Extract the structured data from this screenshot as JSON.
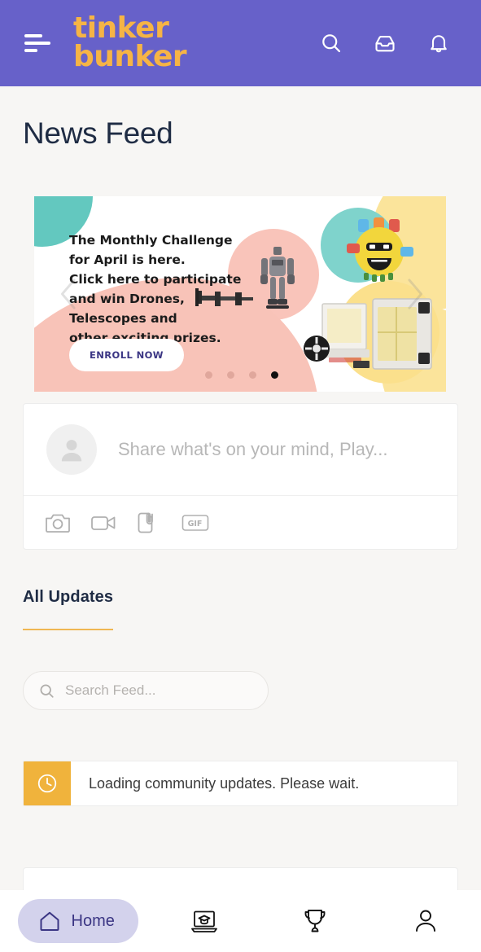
{
  "header": {
    "menu_icon": "hamburger-menu-icon",
    "logo_line1": "tinker",
    "logo_line2": "bunker",
    "logo_color": "#f6b445",
    "bg_color": "#6761c9",
    "actions": [
      {
        "name": "search-icon",
        "label": "Search"
      },
      {
        "name": "inbox-icon",
        "label": "Inbox"
      },
      {
        "name": "bell-icon",
        "label": "Notifications"
      }
    ]
  },
  "page": {
    "title": "News Feed"
  },
  "banner": {
    "text_lines": [
      "The Monthly Challenge",
      "for April is here.",
      "Click here to participate",
      "and win Drones,",
      "Telescopes and",
      "other exciting prizes."
    ],
    "cta_label": "ENROLL NOW",
    "cta_text_color": "#3b3684",
    "prev_arrow": "chevron-left-icon",
    "next_arrow": "chevron-right-icon",
    "dot_count": 4,
    "active_dot_index": 3,
    "accent_teal": "#63c8bf",
    "accent_pink": "#f8c3b8",
    "accent_yellow": "#fbe49b"
  },
  "composer": {
    "placeholder": "Share what's on your mind, Play...",
    "value": "",
    "avatar_name": "default-user-avatar",
    "attachments": [
      {
        "name": "camera-icon",
        "label": "Photo"
      },
      {
        "name": "video-camera-icon",
        "label": "Video"
      },
      {
        "name": "attachment-icon",
        "label": "Attachment"
      },
      {
        "name": "gif-icon",
        "label": "GIF"
      }
    ]
  },
  "feed": {
    "tab_label": "All Updates",
    "tab_active": true,
    "tab_underline_color": "#f0b752",
    "search_placeholder": "Search Feed...",
    "search_value": "",
    "search_icon": "search-icon",
    "loading_message": "Loading community updates. Please wait.",
    "loading_icon": "clock-icon",
    "loading_icon_bg": "#f0b33c"
  },
  "bottom_nav": {
    "items": [
      {
        "name": "nav-home",
        "label": "Home",
        "icon": "home-icon",
        "active": true
      },
      {
        "name": "nav-courses",
        "label": "",
        "icon": "laptop-graduation-icon",
        "active": false
      },
      {
        "name": "nav-rewards",
        "label": "",
        "icon": "trophy-icon",
        "active": false
      },
      {
        "name": "nav-profile",
        "label": "",
        "icon": "person-icon",
        "active": false
      }
    ],
    "active_pill_bg": "#d3d2ec",
    "active_text_color": "#3b3684"
  }
}
